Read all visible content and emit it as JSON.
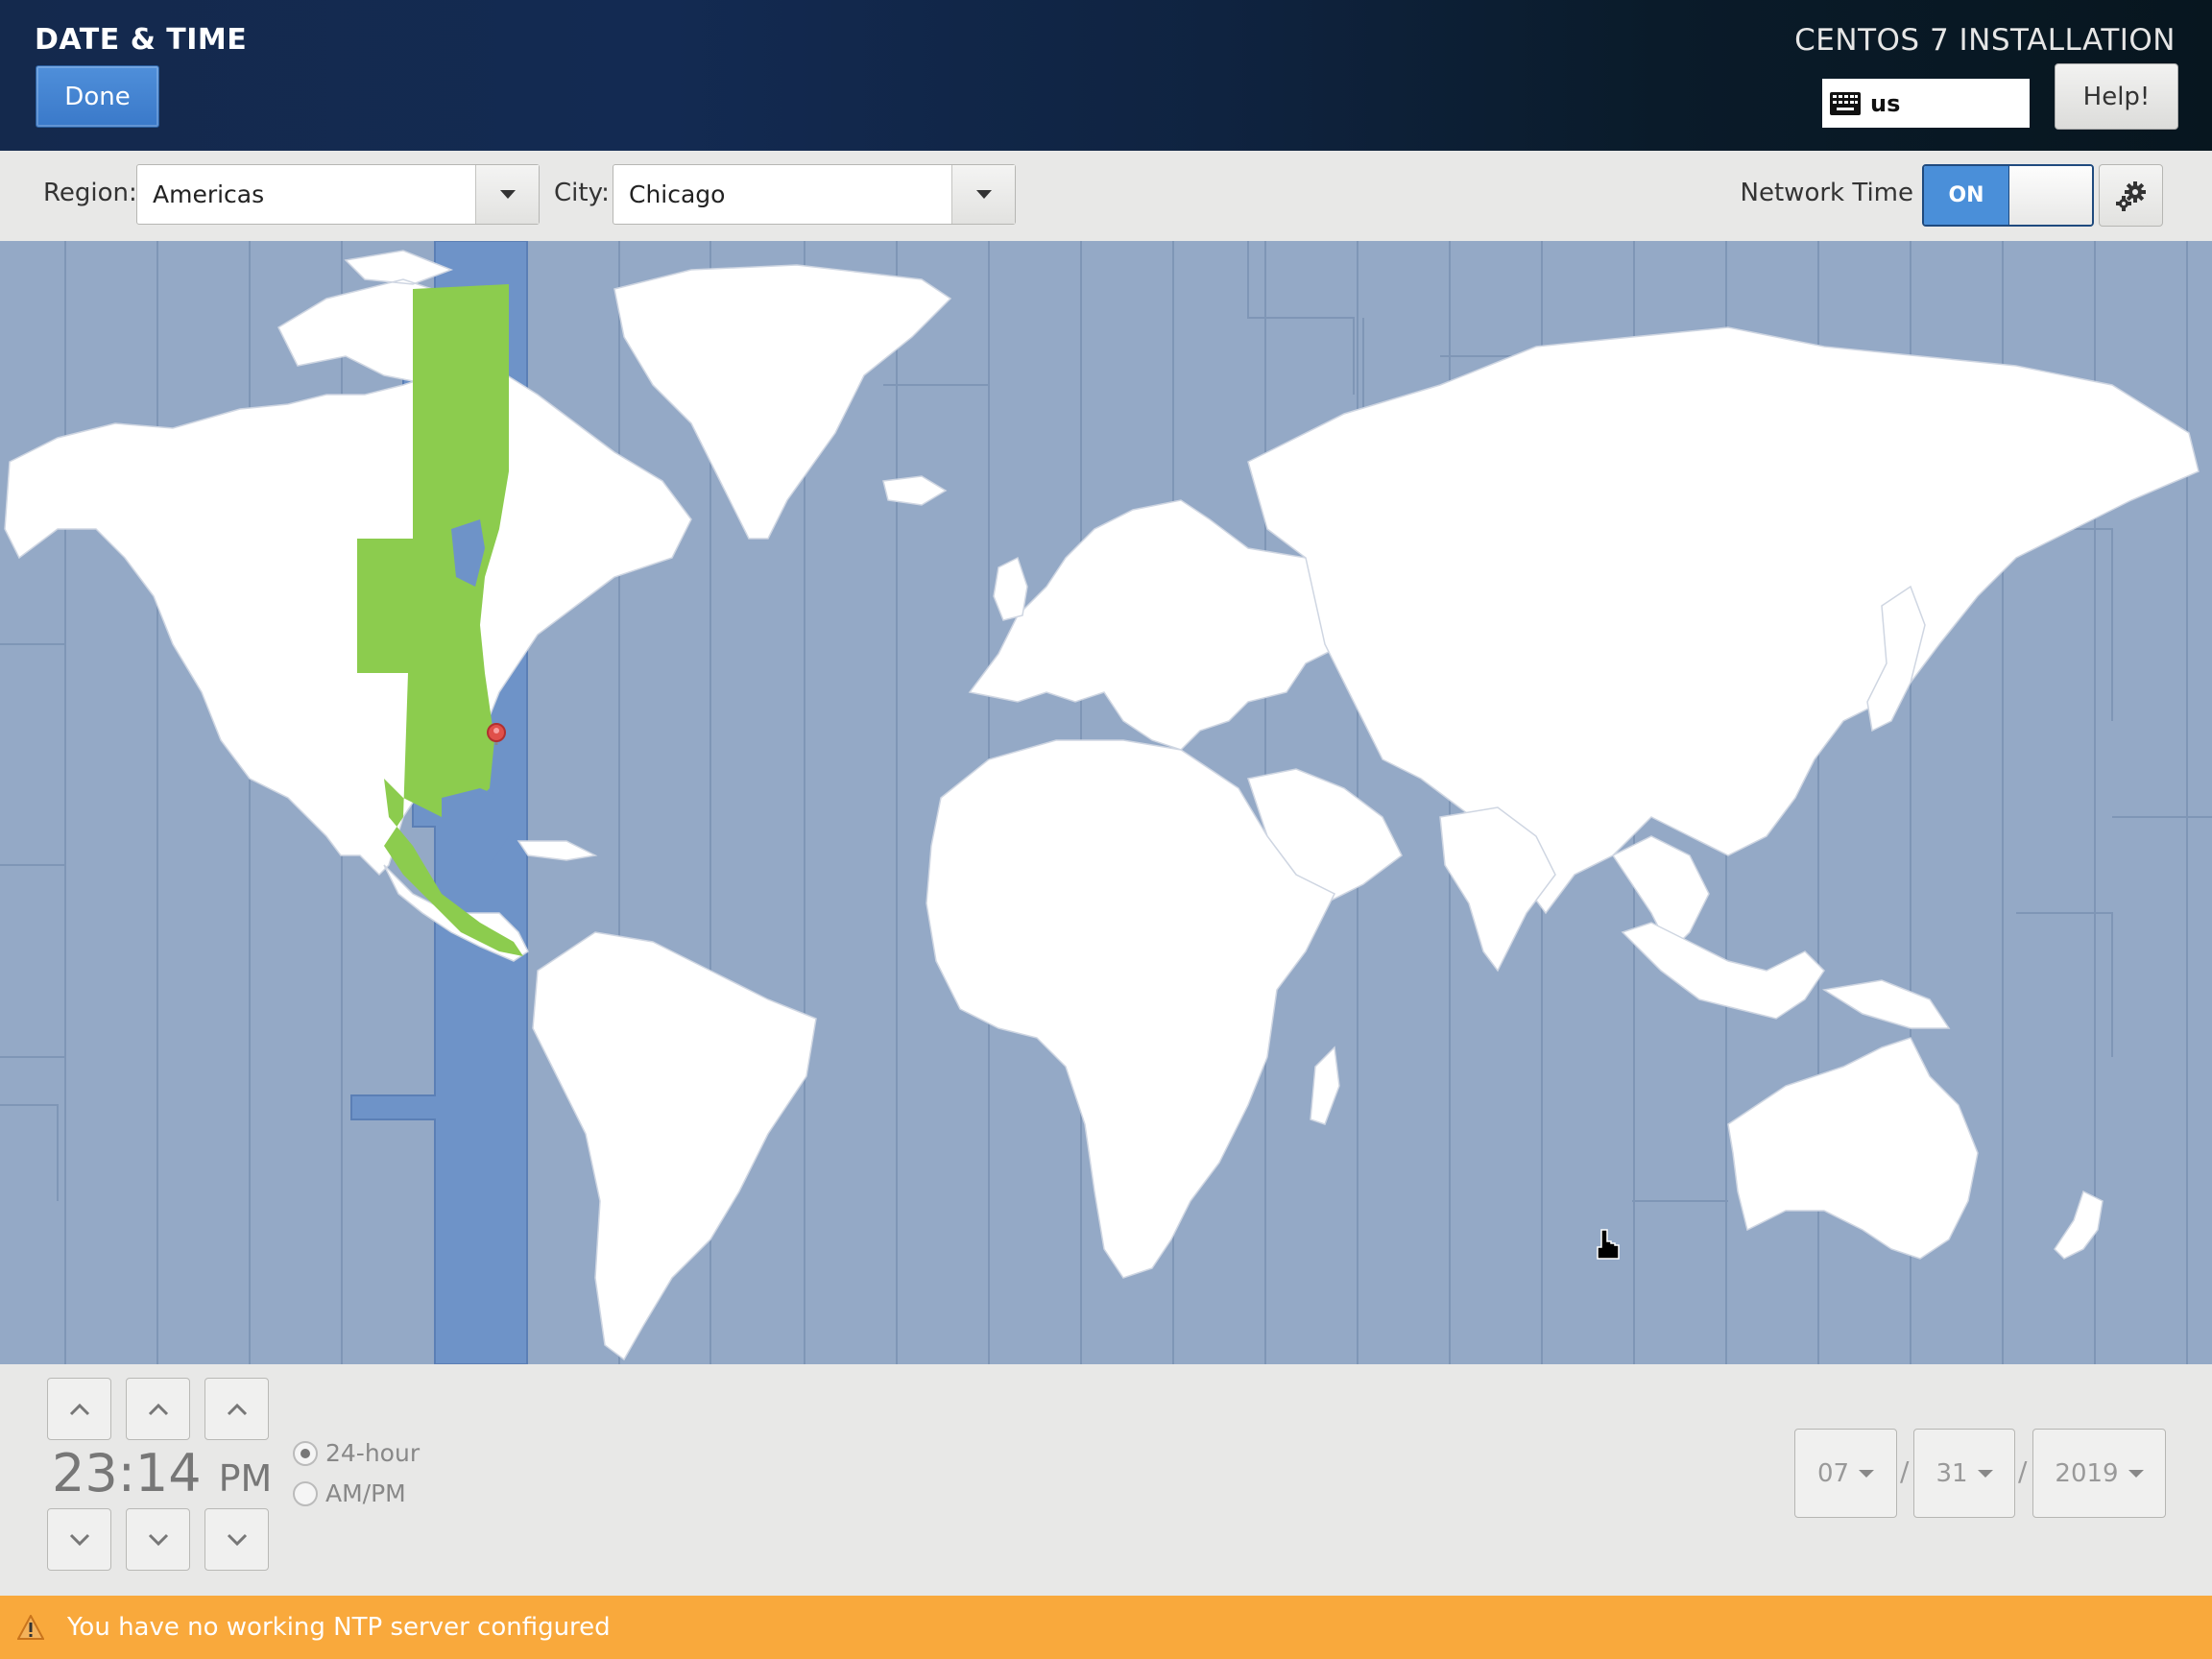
{
  "header": {
    "title": "DATE & TIME",
    "done_label": "Done",
    "product_title": "CENTOS 7 INSTALLATION",
    "keyboard_layout": "us",
    "help_label": "Help!"
  },
  "toolbar": {
    "region_label": "Region:",
    "region_value": "Americas",
    "city_label": "City:",
    "city_value": "Chicago",
    "network_time_label": "Network Time",
    "network_time_state": "ON"
  },
  "map": {
    "selected_timezone": "America/Chicago",
    "colors": {
      "ocean": "#94a9c6",
      "land": "#ffffff",
      "selected_band": "#6e93c8",
      "selected_region": "#8ccc4e",
      "pin": "#e0504a"
    }
  },
  "time": {
    "hours": "23",
    "separator": ":",
    "minutes": "14",
    "ampm": "PM",
    "format_24h_label": "24-hour",
    "format_ampm_label": "AM/PM",
    "selected_format": "24-hour"
  },
  "date": {
    "month": "07",
    "day": "31",
    "year": "2019",
    "separator": "/"
  },
  "footer": {
    "warning": "You have no working NTP server configured",
    "color": "#f9a93c"
  }
}
